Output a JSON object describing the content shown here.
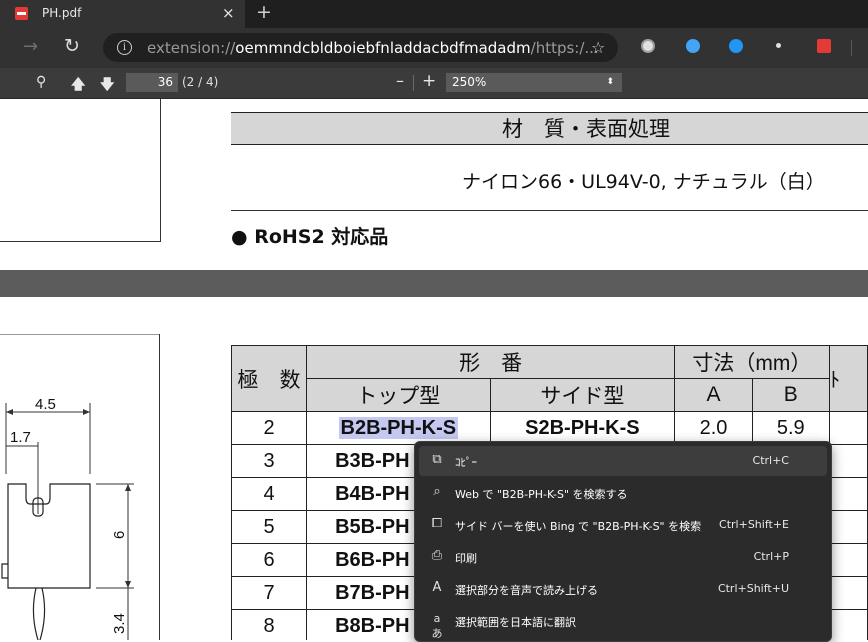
{
  "tab": {
    "title": "PH.pdf",
    "close": "×",
    "new_tab": "+"
  },
  "address": {
    "scheme": "extension://",
    "host": "oemmndcbldboiebfnladdacbdfmadadm",
    "rest": "/https:/..."
  },
  "pdf_toolbar": {
    "page_input": "36",
    "page_count": "(2 / 4)",
    "zoom_minus": "–",
    "zoom_plus": "+",
    "zoom_value": "250%"
  },
  "document": {
    "material_header": "材　質・表面処理",
    "material_value": "ナイロン66・UL94V-0, ナチュラル（白）",
    "rohs": "● RoHS2 対応品",
    "drawing": {
      "dim_45": "4.5",
      "dim_17": "1.7",
      "dim_6": "6",
      "dim_34": "3.4"
    },
    "table": {
      "h_poles": "極　数",
      "h_model": "形　番",
      "h_dims": "寸法（mm）",
      "h_top": "トップ型",
      "h_side": "サイド型",
      "h_a": "A",
      "h_b": "B",
      "h_cut": "ﾄ",
      "rows": [
        {
          "poles": "2",
          "top": "B2B-PH-K-S",
          "side": "S2B-PH-K-S",
          "a": "2.0",
          "b": "5.9"
        },
        {
          "poles": "3",
          "top": "B3B-PH"
        },
        {
          "poles": "4",
          "top": "B4B-PH"
        },
        {
          "poles": "5",
          "top": "B5B-PH"
        },
        {
          "poles": "6",
          "top": "B6B-PH"
        },
        {
          "poles": "7",
          "top": "B7B-PH"
        },
        {
          "poles": "8",
          "top": "B8B-PH"
        }
      ]
    }
  },
  "context_menu": {
    "items": [
      {
        "icon": "copy-icon",
        "glyph": "⧉",
        "label": "ｺﾋﾟｰ",
        "shortcut": "Ctrl+C"
      },
      {
        "icon": "search-icon",
        "glyph": "⌕",
        "label": "Web で \"B2B-PH-K-S\" を検索する",
        "shortcut": ""
      },
      {
        "icon": "sidebar-search-icon",
        "glyph": "⧠",
        "label": "サイド バーを使い Bing で \"B2B-PH-K-S\" を検索",
        "shortcut": "Ctrl+Shift+E"
      },
      {
        "icon": "print-icon",
        "glyph": "⎙",
        "label": "印刷",
        "shortcut": "Ctrl+P"
      },
      {
        "icon": "read-aloud-icon",
        "glyph": "A",
        "label": "選択部分を音声で読み上げる",
        "shortcut": "Ctrl+Shift+U"
      },
      {
        "icon": "translate-icon",
        "glyph": "aあ",
        "label": "選択範囲を日本語に翻訳",
        "shortcut": ""
      }
    ]
  }
}
